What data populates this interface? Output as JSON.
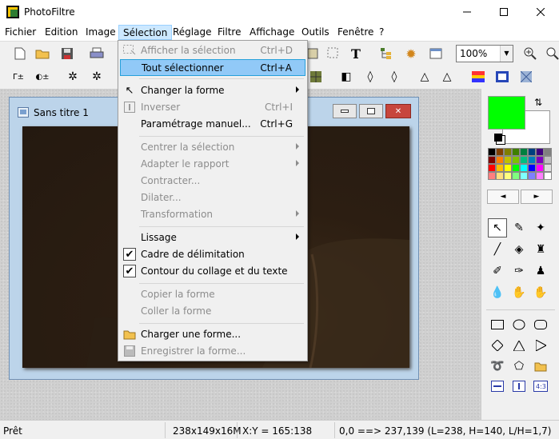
{
  "window": {
    "title": "PhotoFiltre"
  },
  "menubar": {
    "items": [
      "Fichier",
      "Edition",
      "Image",
      "Sélection",
      "Réglage",
      "Filtre",
      "Affichage",
      "Outils",
      "Fenêtre",
      "?"
    ]
  },
  "toolbar": {
    "zoom_value": "100%"
  },
  "document": {
    "title": "Sans titre 1"
  },
  "selection_menu": {
    "items": [
      {
        "label": "Afficher la sélection",
        "shortcut": "Ctrl+D",
        "enabled": false
      },
      {
        "label": "Tout sélectionner",
        "shortcut": "Ctrl+A",
        "enabled": true,
        "highlighted": true
      },
      {
        "label": "Changer la forme",
        "enabled": true,
        "submenu": true
      },
      {
        "label": "Inverser",
        "shortcut": "Ctrl+I",
        "enabled": false
      },
      {
        "label": "Paramétrage manuel...",
        "shortcut": "Ctrl+G",
        "enabled": true
      },
      {
        "label": "Centrer la sélection",
        "enabled": false,
        "submenu": true
      },
      {
        "label": "Adapter le rapport",
        "enabled": false,
        "submenu": true
      },
      {
        "label": "Contracter...",
        "enabled": false
      },
      {
        "label": "Dilater...",
        "enabled": false
      },
      {
        "label": "Transformation",
        "enabled": false,
        "submenu": true
      },
      {
        "label": "Lissage",
        "enabled": true,
        "submenu": true
      },
      {
        "label": "Cadre de délimitation",
        "enabled": true,
        "checked": true
      },
      {
        "label": "Contour du collage et du texte",
        "enabled": true,
        "checked": true
      },
      {
        "label": "Copier la forme",
        "enabled": false
      },
      {
        "label": "Coller la forme",
        "enabled": false
      },
      {
        "label": "Charger une forme...",
        "enabled": true
      },
      {
        "label": "Enregistrer la forme...",
        "enabled": false
      }
    ]
  },
  "colors": {
    "foreground": "#00ff00",
    "background": "#ffffff",
    "highlight": "#91c9f7"
  },
  "palette": [
    "#000000",
    "#7f3f00",
    "#7f7f00",
    "#3f7f00",
    "#007f3f",
    "#003f7f",
    "#3f007f",
    "#7f7f7f",
    "#7f0000",
    "#ff7f00",
    "#bfbf00",
    "#7fbf00",
    "#00bf7f",
    "#007fbf",
    "#7f00bf",
    "#bfbfbf",
    "#ff0000",
    "#ffbf00",
    "#ffff00",
    "#00ff00",
    "#00ffff",
    "#0000ff",
    "#ff00ff",
    "#e0e0e0",
    "#ff7f7f",
    "#ffdf7f",
    "#ffff7f",
    "#7fff7f",
    "#7fffff",
    "#7f7fff",
    "#ff7fff",
    "#ffffff"
  ],
  "status": {
    "ready": "Prêt",
    "size": "238x149x16M",
    "coords": "X:Y = 165:138",
    "selection": "0,0 ==> 237,139 (L=238, H=140, L/H=1,7)"
  }
}
